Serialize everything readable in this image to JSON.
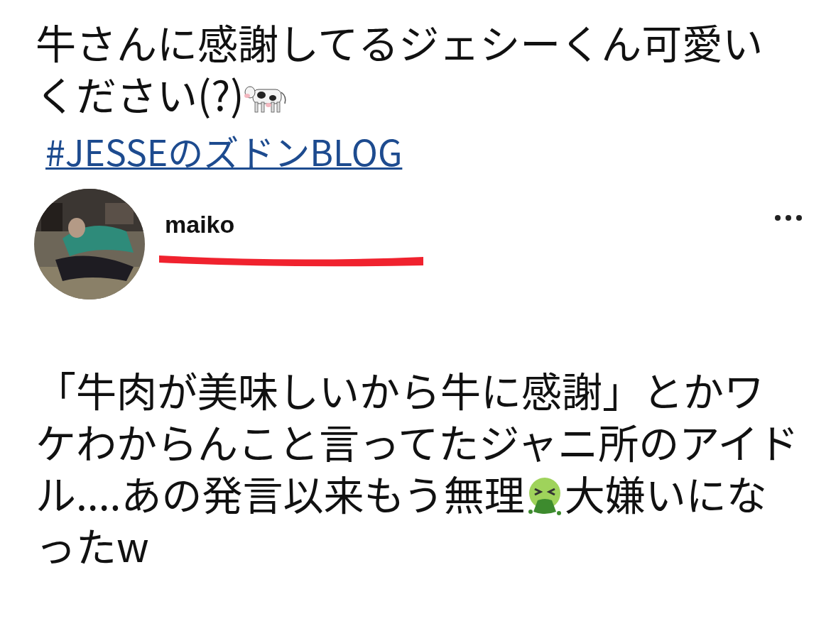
{
  "quoted_post": {
    "text": [
      {
        "kind": "text",
        "text": "牛さんに感謝してるジェシーくん可愛いください(?)"
      },
      {
        "kind": "cow-emoji"
      }
    ],
    "hashtag": "#JESSEのズドンBLOG"
  },
  "post": {
    "author": {
      "name": "maiko",
      "handle_redacted": true
    },
    "text": [
      {
        "kind": "text",
        "text": "「牛肉が美味しいから牛に感謝」とかワケわからんこと言ってたジャニ所のアイドル....あの発言以来もう無理"
      },
      {
        "kind": "nauseated-emoji"
      },
      {
        "kind": "text",
        "text": "大嫌いになったw"
      }
    ]
  }
}
